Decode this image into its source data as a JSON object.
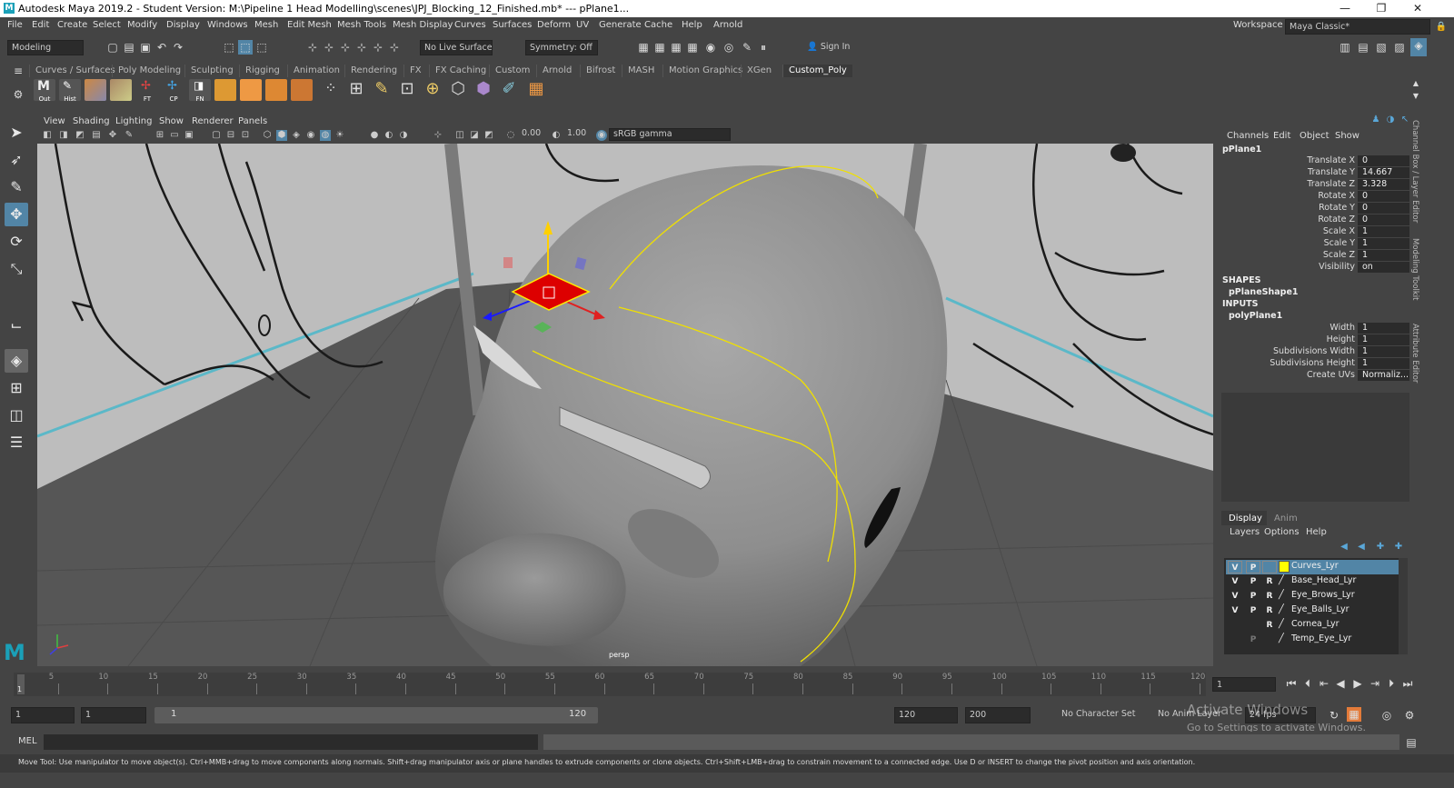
{
  "window": {
    "title": "Autodesk Maya 2019.2 - Student Version: M:\\Pipeline 1 Head Modelling\\scenes\\JPJ_Blocking_12_Finished.mb*  ---  pPlane1...",
    "minimize": "—",
    "restore": "❐",
    "close": "✕"
  },
  "menubar": {
    "items": [
      "File",
      "Edit",
      "Create",
      "Select",
      "Modify",
      "Display",
      "Windows",
      "Mesh",
      "Edit Mesh",
      "Mesh Tools",
      "Mesh Display",
      "Curves",
      "Surfaces",
      "Deform",
      "UV",
      "Generate",
      "Cache",
      "Help",
      "Arnold"
    ],
    "workspace_label": "Workspace :",
    "workspace_value": "Maya Classic*"
  },
  "statusline": {
    "menuset": "Modeling",
    "live_surface": "No Live Surface",
    "symmetry": "Symmetry: Off",
    "sign_in": "Sign In"
  },
  "shelf": {
    "tabs": [
      "Curves / Surfaces",
      "Poly Modeling",
      "Sculpting",
      "Rigging",
      "Animation",
      "Rendering",
      "FX",
      "FX Caching",
      "Custom",
      "Arnold",
      "Bifrost",
      "MASH",
      "Motion Graphics",
      "XGen",
      "Custom_Poly"
    ],
    "active_tab": "Custom_Poly",
    "buttons": [
      {
        "label": "Out",
        "icon": "m-icon"
      },
      {
        "label": "Hist",
        "icon": "history-icon"
      },
      {
        "label": "",
        "icon": "grid-icon"
      },
      {
        "label": "",
        "icon": "grid-icon"
      },
      {
        "label": "FT",
        "icon": "freeze-icon"
      },
      {
        "label": "CP",
        "icon": "center-pivot-icon"
      },
      {
        "label": "FN",
        "icon": "normals-icon"
      }
    ]
  },
  "panel": {
    "menus": [
      "View",
      "Shading",
      "Lighting",
      "Show",
      "Renderer",
      "Panels"
    ],
    "exposure": "0.00",
    "gamma": "1.00",
    "color_space": "sRGB gamma",
    "camera_label": "persp"
  },
  "channel_box": {
    "menus": [
      "Channels",
      "Edit",
      "Object",
      "Show"
    ],
    "object": "pPlane1",
    "attrs": [
      {
        "label": "Translate X",
        "value": "0"
      },
      {
        "label": "Translate Y",
        "value": "14.667"
      },
      {
        "label": "Translate Z",
        "value": "3.328"
      },
      {
        "label": "Rotate X",
        "value": "0"
      },
      {
        "label": "Rotate Y",
        "value": "0"
      },
      {
        "label": "Rotate Z",
        "value": "0"
      },
      {
        "label": "Scale X",
        "value": "1"
      },
      {
        "label": "Scale Y",
        "value": "1"
      },
      {
        "label": "Scale Z",
        "value": "1"
      },
      {
        "label": "Visibility",
        "value": "on"
      }
    ],
    "shapes_header": "SHAPES",
    "shape_name": "pPlaneShape1",
    "inputs_header": "INPUTS",
    "input_name": "polyPlane1",
    "input_attrs": [
      {
        "label": "Width",
        "value": "1"
      },
      {
        "label": "Height",
        "value": "1"
      },
      {
        "label": "Subdivisions Width",
        "value": "1"
      },
      {
        "label": "Subdivisions Height",
        "value": "1"
      },
      {
        "label": "Create UVs",
        "value": "Normaliz..."
      }
    ]
  },
  "layer_editor": {
    "tabs": [
      "Display",
      "Anim"
    ],
    "menus": [
      "Layers",
      "Options",
      "Help"
    ],
    "layers": [
      {
        "v": "V",
        "p": "P",
        "r": "",
        "name": "Curves_Lyr",
        "color": "#ffff00",
        "selected": true
      },
      {
        "v": "V",
        "p": "P",
        "r": "R",
        "name": "Base_Head_Lyr",
        "color": "",
        "selected": false
      },
      {
        "v": "V",
        "p": "P",
        "r": "R",
        "name": "Eye_Brows_Lyr",
        "color": "",
        "selected": false
      },
      {
        "v": "V",
        "p": "P",
        "r": "R",
        "name": "Eye_Balls_Lyr",
        "color": "",
        "selected": false
      },
      {
        "v": "",
        "p": "",
        "r": "R",
        "name": "Cornea_Lyr",
        "color": "",
        "selected": false
      },
      {
        "v": "",
        "p": "P",
        "r": "",
        "name": "Temp_Eye_Lyr",
        "color": "",
        "selected": false
      }
    ]
  },
  "side_tabs": [
    "Channel Box / Layer Editor",
    "Modeling Toolkit",
    "Attribute Editor"
  ],
  "timeline": {
    "ticks": [
      "5",
      "10",
      "15",
      "20",
      "25",
      "30",
      "35",
      "40",
      "45",
      "50",
      "55",
      "60",
      "65",
      "70",
      "75",
      "80",
      "85",
      "90",
      "95",
      "100",
      "105",
      "110",
      "115",
      "120"
    ],
    "start_tick": "1",
    "current_frame": "1"
  },
  "range": {
    "start": "1",
    "start2": "1",
    "slider_start": "1",
    "slider_end": "120",
    "end": "120",
    "end2": "200",
    "character_set": "No Character Set",
    "anim_layer": "No Anim Layer",
    "fps": "24 fps"
  },
  "watermark": {
    "line1": "Activate Windows",
    "line2": "Go to Settings to activate Windows."
  },
  "command": {
    "lang": "MEL"
  },
  "help_line": "Move Tool: Use manipulator to move object(s). Ctrl+MMB+drag to move components along normals. Shift+drag manipulator axis or plane handles to extrude components or clone objects. Ctrl+Shift+LMB+drag to constrain movement to a connected edge. Use D or INSERT to change the pivot position and axis orientation.",
  "colors": {
    "accent": "#5285a6",
    "selected_layer": "#5285a6",
    "manip_red": "#e00000",
    "manip_yellow": "#ffe000",
    "curve_yellow": "#f0e000",
    "grid_line": "#5bb8c8"
  }
}
